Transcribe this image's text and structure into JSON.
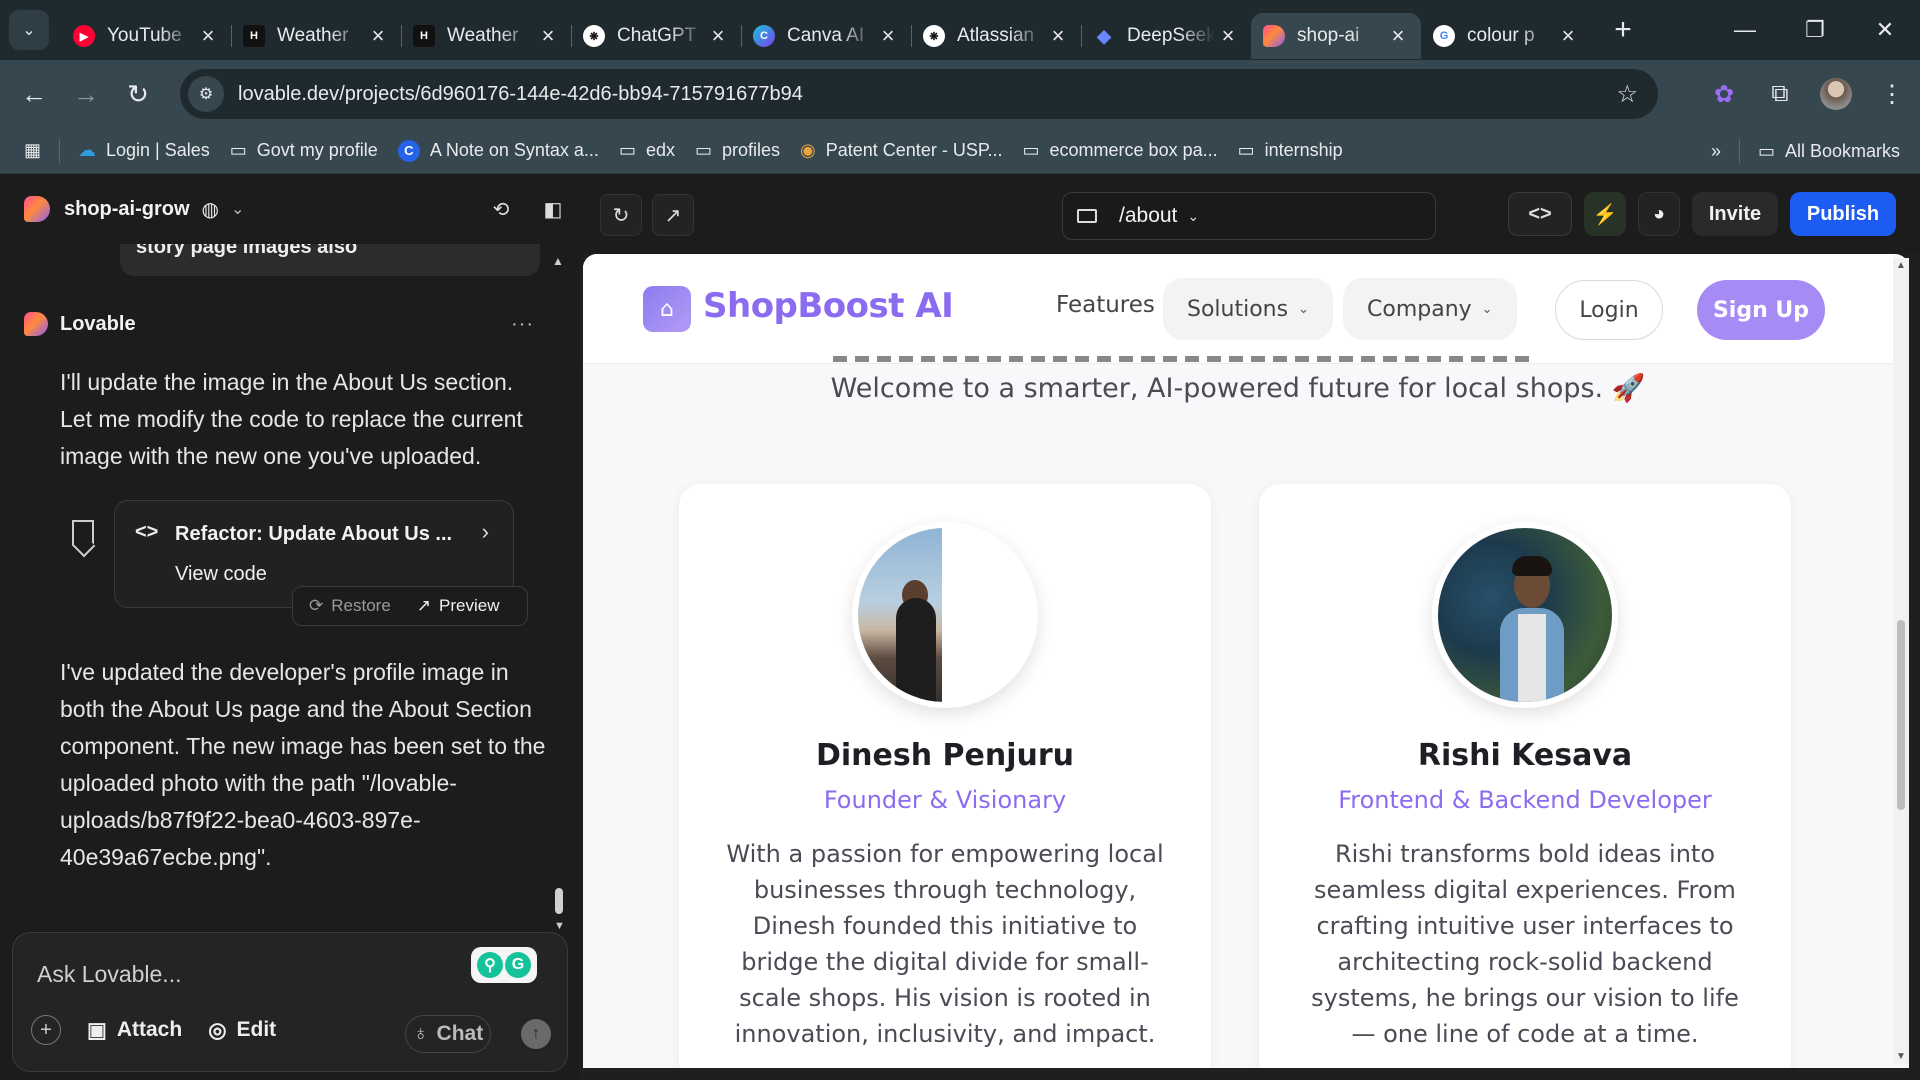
{
  "browser": {
    "tabs": [
      {
        "title": "YouTube",
        "icon": "youtube-icon",
        "color": "#ff0033",
        "glyph": "▶"
      },
      {
        "title": "Weather",
        "icon": "weather-icon",
        "color": "#111111",
        "glyph": "H"
      },
      {
        "title": "Weather",
        "icon": "weather-icon",
        "color": "#111111",
        "glyph": "H"
      },
      {
        "title": "ChatGPT",
        "icon": "chatgpt-icon",
        "color": "#ffffff",
        "glyph": "❋"
      },
      {
        "title": "Canva AI",
        "icon": "canva-icon",
        "color": "#2e8ff0",
        "glyph": "C"
      },
      {
        "title": "Atlassian",
        "icon": "atlassian-icon",
        "color": "#ffffff",
        "glyph": "❋"
      },
      {
        "title": "DeepSeek",
        "icon": "deepseek-icon",
        "color": "#4d6bfe",
        "glyph": "◆"
      },
      {
        "title": "shop-ai",
        "icon": "lovable-icon",
        "color": "#ff6a5c",
        "glyph": "♥"
      },
      {
        "title": "colour p",
        "icon": "google-icon",
        "color": "#ffffff",
        "glyph": "G"
      }
    ],
    "url_host": "lovable.dev",
    "url_path": "/projects/6d960176-144e-42d6-bb94-715791677b94",
    "bookmarks": [
      {
        "label": "Login | Sales",
        "icon": "cloud-icon"
      },
      {
        "label": "Govt  my profile",
        "icon": "folder-icon"
      },
      {
        "label": "A Note on Syntax a...",
        "icon": "c-site-icon"
      },
      {
        "label": "edx",
        "icon": "folder-icon"
      },
      {
        "label": "profiles",
        "icon": "folder-icon"
      },
      {
        "label": "Patent Center - USP...",
        "icon": "patent-icon"
      },
      {
        "label": "ecommerce box pa...",
        "icon": "folder-icon"
      },
      {
        "label": "internship",
        "icon": "folder-icon"
      }
    ],
    "all_bookmarks": "All Bookmarks"
  },
  "editor": {
    "project_name": "shop-ai-grow",
    "prev_message": "story page images also",
    "assistant_name": "Lovable",
    "message1": "I'll update the image in the About Us section. Let me modify the code to replace the current image with the new one you've uploaded.",
    "card_title": "Refactor: Update About Us ...",
    "card_view": "View code",
    "restore": "Restore",
    "preview": "Preview",
    "message2": "I've updated the developer's profile image in both the About Us page and the About Section component. The new image has been set to the uploaded photo with the path \"/lovable-uploads/b87f9f22-bea0-4603-897e-40e39a67ecbe.png\".",
    "chat_placeholder": "Ask Lovable...",
    "attach": "Attach",
    "edit": "Edit",
    "chat": "Chat"
  },
  "preview_bar": {
    "route": "/about",
    "invite": "Invite",
    "publish": "Publish",
    "publish_color": "#1d5cf2"
  },
  "site": {
    "brand": "ShopBoost AI",
    "brand_color": "#8b6cf0",
    "nav": {
      "features": "Features",
      "solutions": "Solutions",
      "company": "Company",
      "login": "Login",
      "signup": "Sign Up"
    },
    "welcome": "Welcome to a smarter, AI-powered future for local shops. 🚀",
    "members": [
      {
        "name": "Dinesh Penjuru",
        "role": "Founder & Visionary",
        "bio": "With a passion for empowering local businesses through technology, Dinesh founded this initiative to bridge the digital divide for small-scale shops. His vision is rooted in innovation, inclusivity, and impact."
      },
      {
        "name": "Rishi Kesava",
        "role": "Frontend & Backend Developer",
        "bio": "Rishi transforms bold ideas into seamless digital experiences. From crafting intuitive user interfaces to architecting rock-solid backend systems, he brings our vision to life — one line of code at a time."
      }
    ]
  }
}
